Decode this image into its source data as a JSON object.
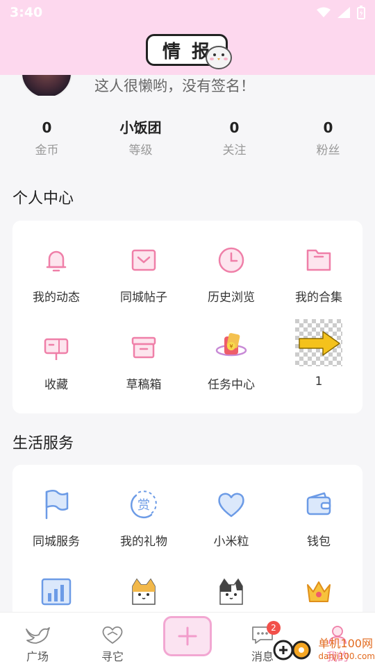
{
  "status": {
    "time": "3:40"
  },
  "header": {
    "logo_char_1": "情",
    "logo_char_2": "报"
  },
  "profile": {
    "signature": "这人很懒哟，没有签名！"
  },
  "stats": [
    {
      "value": "0",
      "label": "金币"
    },
    {
      "value": "小饭团",
      "label": "等级"
    },
    {
      "value": "0",
      "label": "关注"
    },
    {
      "value": "0",
      "label": "粉丝"
    }
  ],
  "personal": {
    "title": "个人中心",
    "items": [
      {
        "label": "我的动态",
        "icon": "bell-icon"
      },
      {
        "label": "同城帖子",
        "icon": "mail-box-icon"
      },
      {
        "label": "历史浏览",
        "icon": "clock-icon"
      },
      {
        "label": "我的合集",
        "icon": "folder-icon"
      },
      {
        "label": "收藏",
        "icon": "mailbox-icon"
      },
      {
        "label": "草稿箱",
        "icon": "archive-icon"
      },
      {
        "label": "任务中心",
        "icon": "task-planet-icon"
      },
      {
        "label": "1",
        "icon": "yellow-arrow-icon"
      }
    ]
  },
  "services": {
    "title": "生活服务",
    "items": [
      {
        "label": "同城服务",
        "icon": "flag-icon"
      },
      {
        "label": "我的礼物",
        "icon": "reward-icon"
      },
      {
        "label": "小米粒",
        "icon": "heart-icon"
      },
      {
        "label": "钱包",
        "icon": "wallet-icon"
      },
      {
        "label": "",
        "icon": "chart-icon"
      },
      {
        "label": "",
        "icon": "cat-icon"
      },
      {
        "label": "",
        "icon": "cat-dark-icon"
      },
      {
        "label": "",
        "icon": "crown-icon"
      }
    ]
  },
  "tabbar": {
    "tabs": [
      {
        "label": "广场",
        "icon": "bird-icon"
      },
      {
        "label": "寻它",
        "icon": "paw-heart-icon"
      },
      {
        "label": "",
        "icon": "plus-icon"
      },
      {
        "label": "消息",
        "icon": "chat-icon",
        "badge": "2"
      },
      {
        "label": "我的",
        "icon": "user-icon"
      }
    ]
  },
  "watermark": {
    "line1": "单机100网",
    "line2": "danji100.com"
  },
  "colors": {
    "pink_header": "#fdd8ee",
    "pink_accent": "#ef7fa8",
    "blue_accent": "#6c9be6",
    "badge": "#f2504a"
  }
}
